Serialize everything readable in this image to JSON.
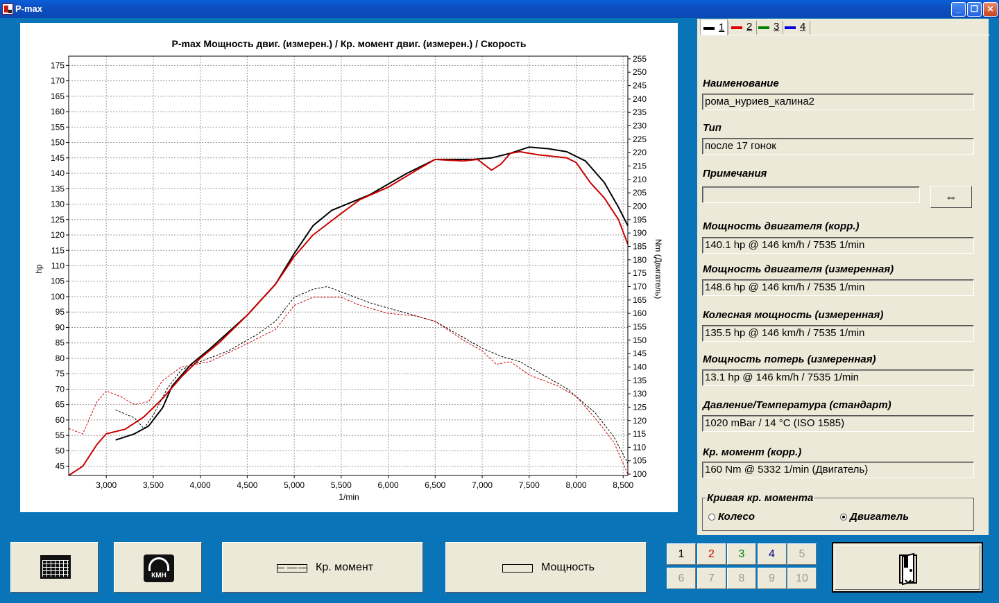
{
  "window": {
    "title": "P-max",
    "buttons": [
      "minimize",
      "maximize",
      "close"
    ]
  },
  "chart_data": {
    "type": "line",
    "title": "P-max Мощность двиг. (измерен.) / Кр. момент двиг. (измерен.) / Скорость",
    "xlabel": "1/min",
    "ylabel": "hp",
    "y2label": "Nm (Двигатель)",
    "xlim": [
      2600,
      8550
    ],
    "ylim": [
      42,
      178
    ],
    "y2lim": [
      99.5,
      256
    ],
    "x_ticks": [
      3000,
      3500,
      4000,
      4500,
      5000,
      5500,
      6000,
      6500,
      7000,
      7500,
      8000,
      8500
    ],
    "x_tick_labels": [
      "3,000",
      "3,500",
      "4,000",
      "4,500",
      "5,000",
      "5,500",
      "6,000",
      "6,500",
      "7,000",
      "7,500",
      "8,000",
      "8,500"
    ],
    "y_ticks": [
      45,
      50,
      55,
      60,
      65,
      70,
      75,
      80,
      85,
      90,
      95,
      100,
      105,
      110,
      115,
      120,
      125,
      130,
      135,
      140,
      145,
      150,
      155,
      160,
      165,
      170,
      175
    ],
    "y2_ticks": [
      100,
      105,
      110,
      115,
      120,
      125,
      130,
      135,
      140,
      145,
      150,
      155,
      160,
      165,
      170,
      175,
      180,
      185,
      190,
      195,
      200,
      205,
      210,
      215,
      220,
      225,
      230,
      235,
      240,
      245,
      250,
      255
    ],
    "grid": true,
    "series": [
      {
        "color": "#000000",
        "style": "solid",
        "axis": "left",
        "linewidth": 2,
        "points": [
          [
            3100,
            53.5
          ],
          [
            3300,
            55.5
          ],
          [
            3450,
            58
          ],
          [
            3600,
            64
          ],
          [
            3700,
            71
          ],
          [
            3900,
            78
          ],
          [
            4100,
            83
          ],
          [
            4500,
            94
          ],
          [
            4800,
            104
          ],
          [
            5000,
            114
          ],
          [
            5200,
            123
          ],
          [
            5400,
            128
          ],
          [
            5600,
            130.5
          ],
          [
            5800,
            133
          ],
          [
            6200,
            140
          ],
          [
            6500,
            144.5
          ],
          [
            6900,
            144.5
          ],
          [
            7100,
            145
          ],
          [
            7300,
            146.5
          ],
          [
            7500,
            148.5
          ],
          [
            7700,
            148
          ],
          [
            7900,
            147
          ],
          [
            8100,
            144
          ],
          [
            8300,
            137
          ],
          [
            8450,
            129
          ],
          [
            8550,
            123
          ]
        ]
      },
      {
        "color": "#cc0000",
        "style": "solid",
        "axis": "left",
        "linewidth": 2,
        "points": [
          [
            2600,
            42
          ],
          [
            2750,
            45
          ],
          [
            2900,
            52
          ],
          [
            3000,
            55.5
          ],
          [
            3200,
            57
          ],
          [
            3400,
            61
          ],
          [
            3600,
            67
          ],
          [
            3800,
            74
          ],
          [
            4000,
            80
          ],
          [
            4200,
            85
          ],
          [
            4500,
            94
          ],
          [
            4800,
            104
          ],
          [
            5000,
            113
          ],
          [
            5200,
            120
          ],
          [
            5500,
            127
          ],
          [
            5700,
            131.5
          ],
          [
            6000,
            135.5
          ],
          [
            6300,
            141
          ],
          [
            6500,
            144.5
          ],
          [
            6800,
            144
          ],
          [
            6950,
            144.5
          ],
          [
            7100,
            141
          ],
          [
            7200,
            143
          ],
          [
            7300,
            146.5
          ],
          [
            7400,
            147
          ],
          [
            7600,
            146
          ],
          [
            7900,
            145
          ],
          [
            8000,
            143.5
          ],
          [
            8150,
            137
          ],
          [
            8300,
            132
          ],
          [
            8450,
            125
          ],
          [
            8550,
            117
          ]
        ]
      },
      {
        "color": "#000000",
        "style": "dashed",
        "axis": "right",
        "points": [
          [
            3100,
            124
          ],
          [
            3300,
            121
          ],
          [
            3400,
            117
          ],
          [
            3500,
            122
          ],
          [
            3650,
            132
          ],
          [
            3800,
            139
          ],
          [
            4000,
            142
          ],
          [
            4300,
            146
          ],
          [
            4600,
            152
          ],
          [
            4800,
            157
          ],
          [
            5000,
            166
          ],
          [
            5200,
            169
          ],
          [
            5350,
            170
          ],
          [
            5500,
            168
          ],
          [
            5800,
            164
          ],
          [
            6200,
            160
          ],
          [
            6500,
            157
          ],
          [
            6800,
            151
          ],
          [
            7000,
            147
          ],
          [
            7200,
            144
          ],
          [
            7400,
            142
          ],
          [
            7600,
            138
          ],
          [
            7900,
            132
          ],
          [
            8200,
            123
          ],
          [
            8400,
            114
          ],
          [
            8550,
            104
          ]
        ]
      },
      {
        "color": "#cc0000",
        "style": "dashed",
        "axis": "right",
        "points": [
          [
            2600,
            117
          ],
          [
            2750,
            115
          ],
          [
            2900,
            127
          ],
          [
            3000,
            131
          ],
          [
            3150,
            129
          ],
          [
            3300,
            126
          ],
          [
            3450,
            127
          ],
          [
            3600,
            135
          ],
          [
            3800,
            140
          ],
          [
            4100,
            142
          ],
          [
            4400,
            147
          ],
          [
            4800,
            154
          ],
          [
            5000,
            163
          ],
          [
            5200,
            166
          ],
          [
            5500,
            166
          ],
          [
            5700,
            163
          ],
          [
            6000,
            160
          ],
          [
            6300,
            159
          ],
          [
            6500,
            157
          ],
          [
            6800,
            150
          ],
          [
            7000,
            146
          ],
          [
            7150,
            141
          ],
          [
            7300,
            142
          ],
          [
            7500,
            137
          ],
          [
            7800,
            133
          ],
          [
            8000,
            129
          ],
          [
            8200,
            121
          ],
          [
            8400,
            112
          ],
          [
            8550,
            100
          ]
        ]
      }
    ]
  },
  "tabs": [
    {
      "label": "1",
      "color": "#000000",
      "active": true
    },
    {
      "label": "2",
      "color": "#e00000",
      "active": false
    },
    {
      "label": "3",
      "color": "#008000",
      "active": false
    },
    {
      "label": "4",
      "color": "#0000e0",
      "active": false
    }
  ],
  "fields": {
    "name": {
      "label": "Наименование",
      "value": "рома_нуриев_калина2"
    },
    "type": {
      "label": "Тип",
      "value": "после  17 гонок"
    },
    "notes": {
      "label": "Примечания",
      "value": ""
    },
    "engine_power_corr": {
      "label": "Мощность двигателя (корр.)",
      "value": "140.1 hp @ 146 km/h / 7535 1/min"
    },
    "engine_power_meas": {
      "label": "Мощность двигателя (измеренная)",
      "value": "148.6 hp @ 146 km/h / 7535 1/min"
    },
    "wheel_power": {
      "label": "Колесная мощность (измеренная)",
      "value": "135.5 hp @ 146 km/h / 7535 1/min"
    },
    "loss_power": {
      "label": "Мощность потерь (измеренная)",
      "value": "13.1 hp @ 146 km/h / 7535 1/min"
    },
    "pressure_temp": {
      "label": "Давление/Температура (стандарт)",
      "value": "1020 mBar / 14 °C (ISO 1585)"
    },
    "torque_corr": {
      "label": "Кр. момент (корр.)",
      "value": "160 Nm @ 5332 1/min (Двигатель)"
    }
  },
  "swap_button": {
    "label": "⇔"
  },
  "torque_curve_group": {
    "title": "Кривая кр. момента",
    "options": [
      {
        "label": "Колесо",
        "selected": false
      },
      {
        "label": "Двигатель",
        "selected": true
      }
    ]
  },
  "bottom": {
    "calendar_icon": "calendar-icon",
    "speed_icon_text": "КМН",
    "torque_button": "Кр. момент",
    "power_button": "Мощность",
    "number_buttons": [
      {
        "label": "1",
        "color": "#000000",
        "enabled": true
      },
      {
        "label": "2",
        "color": "#d00000",
        "enabled": true
      },
      {
        "label": "3",
        "color": "#008000",
        "enabled": true
      },
      {
        "label": "4",
        "color": "#000080",
        "enabled": true
      },
      {
        "label": "5",
        "color": "#999999",
        "enabled": false
      },
      {
        "label": "6",
        "color": "#999999",
        "enabled": false
      },
      {
        "label": "7",
        "color": "#999999",
        "enabled": false
      },
      {
        "label": "8",
        "color": "#999999",
        "enabled": false
      },
      {
        "label": "9",
        "color": "#999999",
        "enabled": false
      },
      {
        "label": "10",
        "color": "#999999",
        "enabled": false
      }
    ],
    "exit_icon": "exit-door-icon"
  }
}
